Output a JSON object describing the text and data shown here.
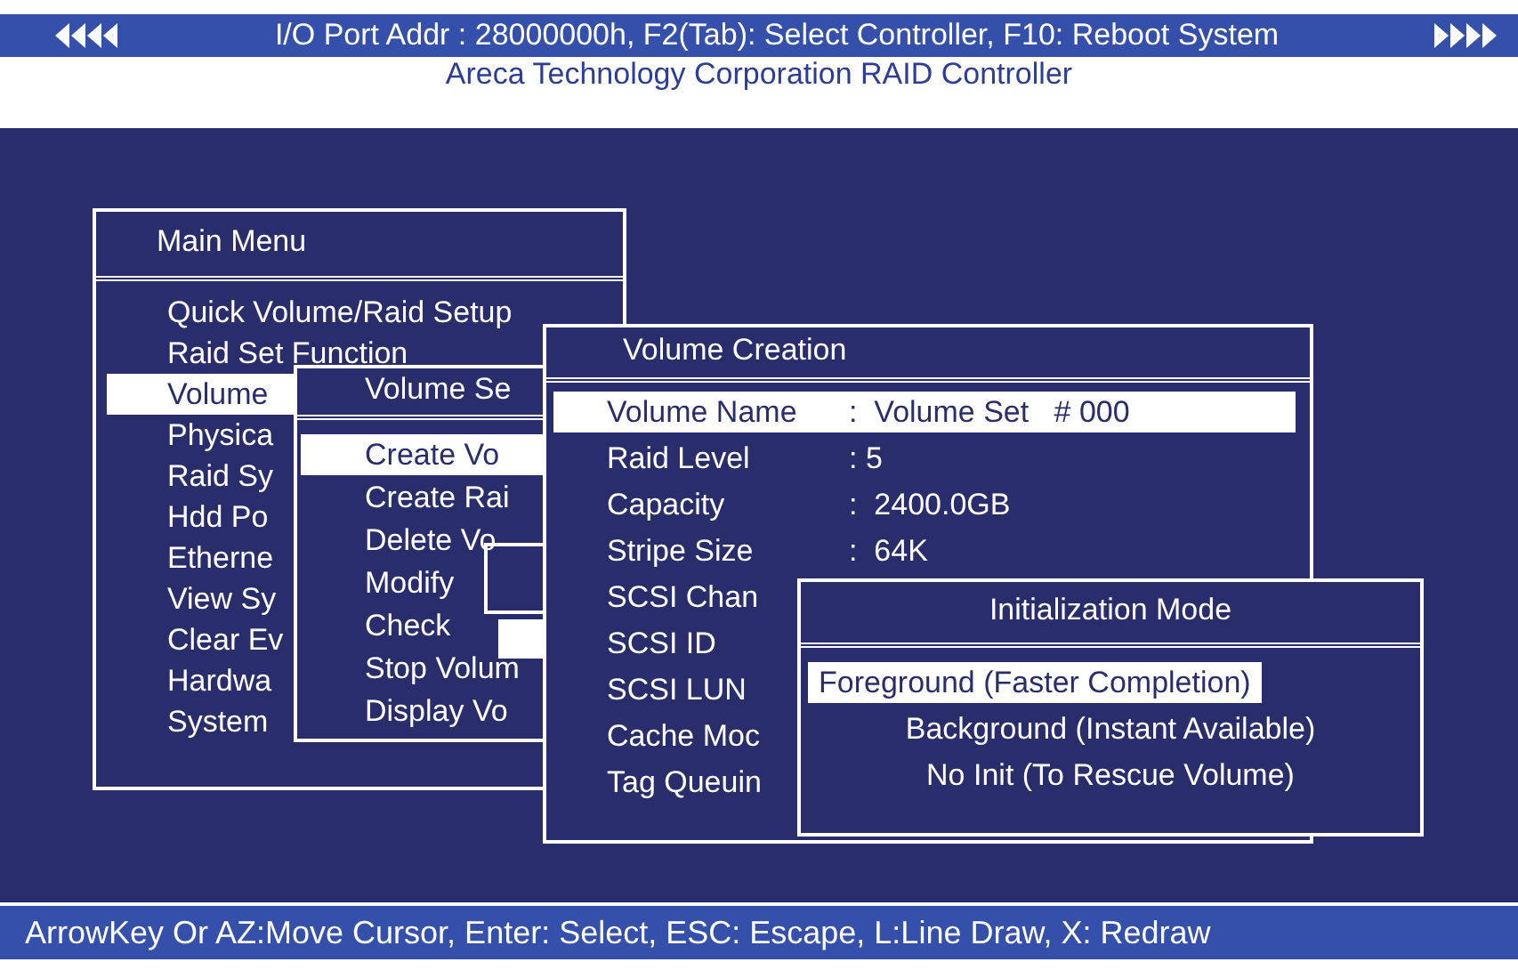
{
  "header": {
    "text": "I/O Port Addr : 28000000h, F2(Tab): Select Controller, F10: Reboot System",
    "subtitle": "Areca Technology Corporation RAID Controller"
  },
  "main_menu": {
    "title": "Main Menu",
    "items": [
      {
        "label": "Quick Volume/Raid Setup",
        "selected": false
      },
      {
        "label": "Raid Set Function",
        "selected": false
      },
      {
        "label": "Volume",
        "selected": true
      },
      {
        "label": "Physica",
        "selected": false
      },
      {
        "label": "Raid Sy",
        "selected": false
      },
      {
        "label": "Hdd Po",
        "selected": false
      },
      {
        "label": "Etherne",
        "selected": false
      },
      {
        "label": "View Sy",
        "selected": false
      },
      {
        "label": "Clear Ev",
        "selected": false
      },
      {
        "label": "Hardwa",
        "selected": false
      },
      {
        "label": "System",
        "selected": false
      }
    ]
  },
  "volume_set_menu": {
    "title": "Volume Se",
    "items": [
      {
        "label": "Create Vo",
        "selected": true
      },
      {
        "label": "Create Rai",
        "selected": false
      },
      {
        "label": "Delete Vo",
        "selected": false
      },
      {
        "label": "Modify",
        "selected": false
      },
      {
        "label": "Check",
        "selected": false
      },
      {
        "label": "Stop Volum",
        "selected": false
      },
      {
        "label": "Display Vo",
        "selected": false
      }
    ]
  },
  "volume_creation": {
    "title": "Volume Creation",
    "rows": [
      {
        "label": "Volume Name",
        "value": ":  Volume Set   # 000",
        "selected": true
      },
      {
        "label": "Raid Level",
        "value": ": 5",
        "selected": false
      },
      {
        "label": "Capacity",
        "value": ":  2400.0GB",
        "selected": false
      },
      {
        "label": "Stripe Size",
        "value": ":  64K",
        "selected": false
      },
      {
        "label": "SCSI  Chan",
        "selected": false
      },
      {
        "label": "SCSI  ID",
        "selected": false
      },
      {
        "label": "SCSI  LUN",
        "selected": false
      },
      {
        "label": "Cache Moc",
        "selected": false
      },
      {
        "label": "Tag Queuin",
        "selected": false
      }
    ]
  },
  "initialization_mode": {
    "title": "Initialization Mode",
    "options": [
      {
        "label": "Foreground (Faster Completion)",
        "selected": true
      },
      {
        "label": "Background (Instant Available)",
        "selected": false
      },
      {
        "label": "No Init (To Rescue Volume)",
        "selected": false
      }
    ]
  },
  "status_bar": "ArrowKey Or AZ:Move Cursor, Enter: Select, ESC: Escape, L:Line Draw, X: Redraw"
}
